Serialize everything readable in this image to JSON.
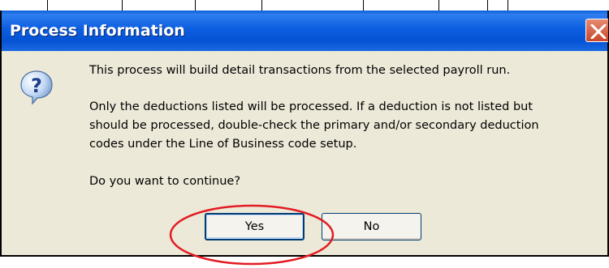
{
  "dialog": {
    "title": "Process Information",
    "icon": "question-icon",
    "message_line1": "This process will build detail transactions from the selected payroll run.",
    "message_para2": [
      "Only the deductions listed will be processed.  If a deduction is not listed but",
      "should be processed, double-check the primary and/or secondary deduction",
      "codes under the Line of Business code setup."
    ],
    "question": "Do you want to continue?",
    "buttons": {
      "yes": "Yes",
      "no": "No"
    },
    "highlighted_button": "Yes"
  },
  "colors": {
    "titlebar": "#0553d4",
    "dialog_bg": "#ece9d8",
    "highlight_circle": "#e31b23",
    "close_button": "#d2603f"
  }
}
